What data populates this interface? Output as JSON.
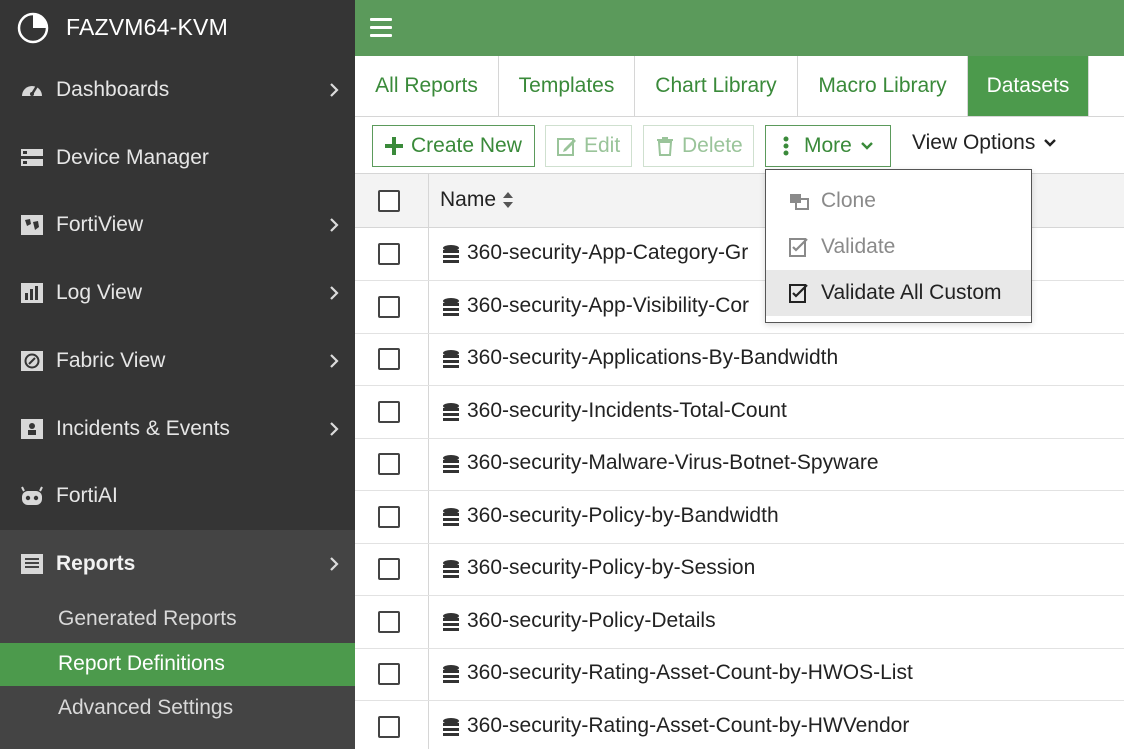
{
  "brand": {
    "title": "FAZVM64-KVM"
  },
  "sidebar": {
    "items": [
      {
        "label": "Dashboards",
        "icon": "speedometer-icon",
        "has_chevron": true
      },
      {
        "label": "Device Manager",
        "icon": "server-icon",
        "has_chevron": false
      },
      {
        "label": "FortiView",
        "icon": "globe-map-icon",
        "has_chevron": true
      },
      {
        "label": "Log View",
        "icon": "bar-log-icon",
        "has_chevron": true
      },
      {
        "label": "Fabric View",
        "icon": "fabric-icon",
        "has_chevron": true
      },
      {
        "label": "Incidents & Events",
        "icon": "incident-icon",
        "has_chevron": true
      },
      {
        "label": "FortiAI",
        "icon": "robot-icon",
        "has_chevron": false
      },
      {
        "label": "Reports",
        "icon": "reports-icon",
        "has_chevron": true,
        "active": true
      }
    ],
    "sub_items": [
      {
        "label": "Generated Reports"
      },
      {
        "label": "Report Definitions",
        "selected": true
      },
      {
        "label": "Advanced Settings"
      }
    ]
  },
  "tabs": [
    {
      "label": "All Reports"
    },
    {
      "label": "Templates"
    },
    {
      "label": "Chart Library"
    },
    {
      "label": "Macro Library"
    },
    {
      "label": "Datasets",
      "active": true
    }
  ],
  "toolbar": {
    "create_new": "Create New",
    "edit": "Edit",
    "delete": "Delete",
    "more": "More",
    "view_options": "View Options"
  },
  "table": {
    "header_name": "Name",
    "rows": [
      "360-security-App-Category-Gr",
      "360-security-App-Visibility-Cor",
      "360-security-Applications-By-Bandwidth",
      "360-security-Incidents-Total-Count",
      "360-security-Malware-Virus-Botnet-Spyware",
      "360-security-Policy-by-Bandwidth",
      "360-security-Policy-by-Session",
      "360-security-Policy-Details",
      "360-security-Rating-Asset-Count-by-HWOS-List",
      "360-security-Rating-Asset-Count-by-HWVendor"
    ]
  },
  "more_menu": {
    "items": [
      {
        "label": "Clone",
        "state": "disabled"
      },
      {
        "label": "Validate",
        "state": "disabled"
      },
      {
        "label": "Validate All Custom",
        "state": "hover"
      }
    ]
  },
  "colors": {
    "accent": "#4c9a4c",
    "topbar": "#5b9a5b",
    "sidebar_bg": "#353535",
    "link_green": "#3a8a3a"
  }
}
